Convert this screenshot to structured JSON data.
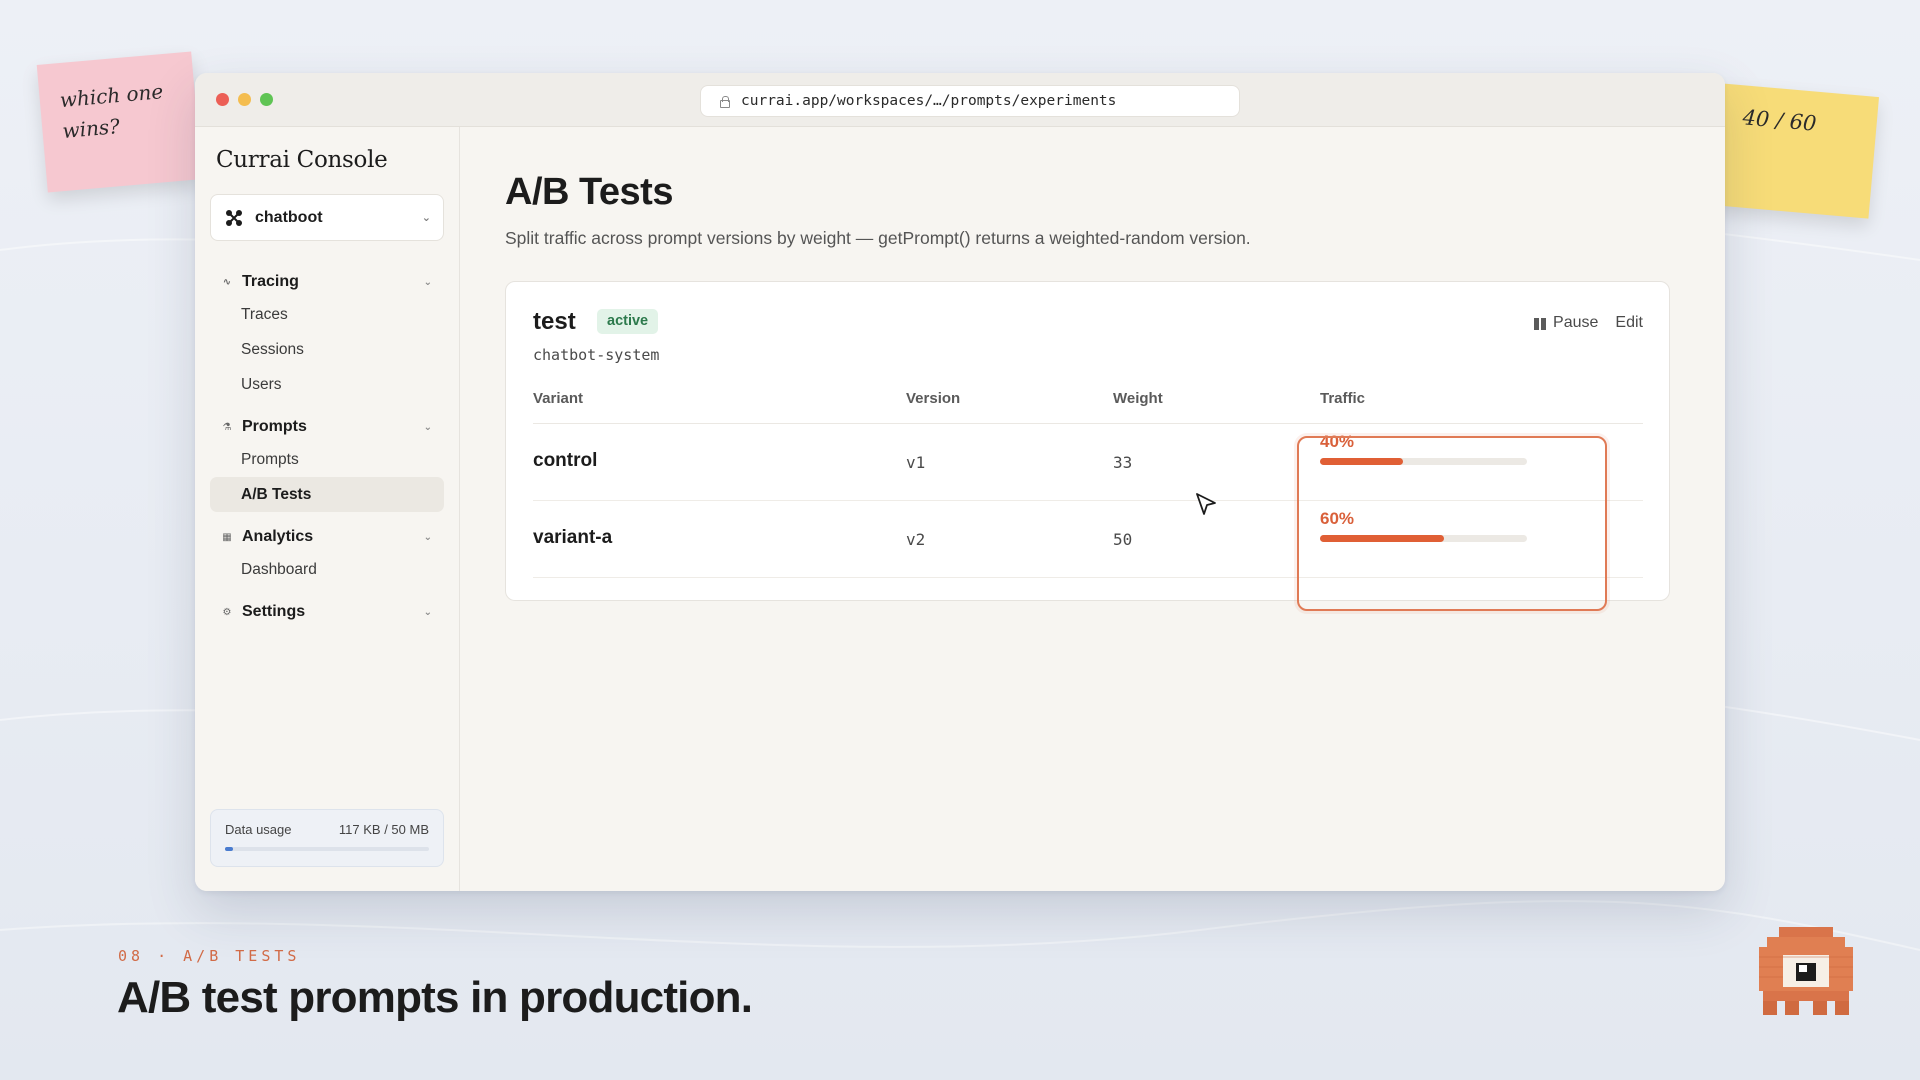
{
  "browser": {
    "url": "currai.app/workspaces/…/prompts/experiments"
  },
  "sidebar": {
    "brand": "Currai Console",
    "project": "chatboot",
    "groups": [
      {
        "label": "Tracing",
        "icon": "activity-icon",
        "items": [
          "Traces",
          "Sessions",
          "Users"
        ]
      },
      {
        "label": "Prompts",
        "icon": "flask-icon",
        "items": [
          "Prompts",
          "A/B Tests"
        ]
      },
      {
        "label": "Analytics",
        "icon": "chart-icon",
        "items": [
          "Dashboard"
        ]
      },
      {
        "label": "Settings",
        "icon": "gear-icon",
        "items": []
      }
    ],
    "active_item": "A/B Tests",
    "usage": {
      "label": "Data usage",
      "value": "117 KB / 50 MB",
      "fraction": 0.0023
    }
  },
  "main": {
    "title": "A/B Tests",
    "subtitle": "Split traffic across prompt versions by weight — getPrompt() returns a weighted-random version.",
    "test": {
      "name": "test",
      "status": "active",
      "prompt": "chatbot-system",
      "actions": {
        "pause": "Pause",
        "edit": "Edit"
      },
      "columns": [
        "Variant",
        "Version",
        "Weight",
        "Traffic"
      ],
      "rows": [
        {
          "variant": "control",
          "version": "v1",
          "weight": "33",
          "traffic": "40%",
          "traffic_pct": 40
        },
        {
          "variant": "variant-a",
          "version": "v2",
          "weight": "50",
          "traffic": "60%",
          "traffic_pct": 60
        }
      ]
    }
  },
  "notes": {
    "pink": [
      "which one",
      "wins?"
    ],
    "yellow": "40 / 60"
  },
  "footer": {
    "eyebrow": "08 · A/B TESTS",
    "title": "A/B test prompts in production."
  },
  "colors": {
    "accent": "#e05f35",
    "badge_bg": "#e2f3e8",
    "badge_text": "#2c7a4c",
    "usage_fill": "#4a7ccf"
  }
}
